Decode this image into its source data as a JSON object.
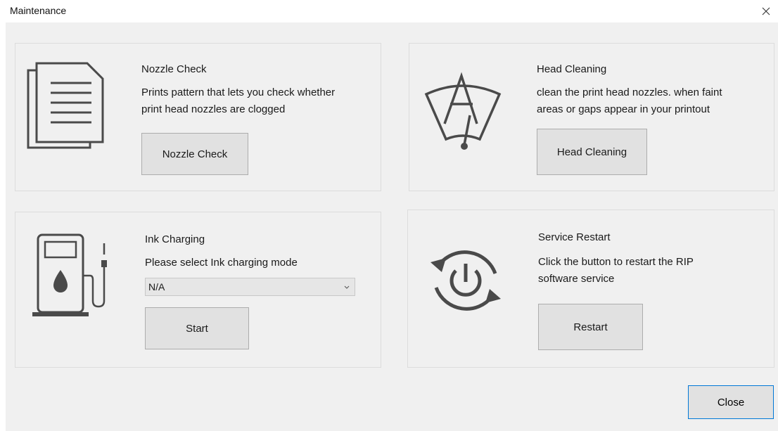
{
  "window": {
    "title": "Maintenance"
  },
  "nozzle": {
    "heading": "Nozzle Check",
    "desc_line1": "Prints pattern that lets you check whether",
    "desc_line2": "print head nozzles are clogged",
    "button": "Nozzle Check"
  },
  "head": {
    "heading": "Head Cleaning",
    "desc_line1": "clean the print head nozzles.  when faint",
    "desc_line2": "areas or gaps appear in your printout",
    "button": "Head Cleaning"
  },
  "ink": {
    "heading": "Ink Charging",
    "desc": "Please select Ink charging mode",
    "select_value": "N/A",
    "button": "Start"
  },
  "service": {
    "heading": "Service Restart",
    "desc_line1": "Click the button to restart the RIP",
    "desc_line2": "software service",
    "button": "Restart"
  },
  "footer": {
    "close_button": "Close"
  },
  "icons": {
    "close": "close-icon",
    "document": "document-icon",
    "head_cleaning": "print-head-icon",
    "ink": "ink-pump-icon",
    "restart": "power-restart-icon",
    "dropdown": "chevron-down-icon"
  },
  "colors": {
    "accent": "#0078d7",
    "icon": "#4a4a4a",
    "panel_bg": "#f0f0f0",
    "button_bg": "#e1e1e1"
  }
}
